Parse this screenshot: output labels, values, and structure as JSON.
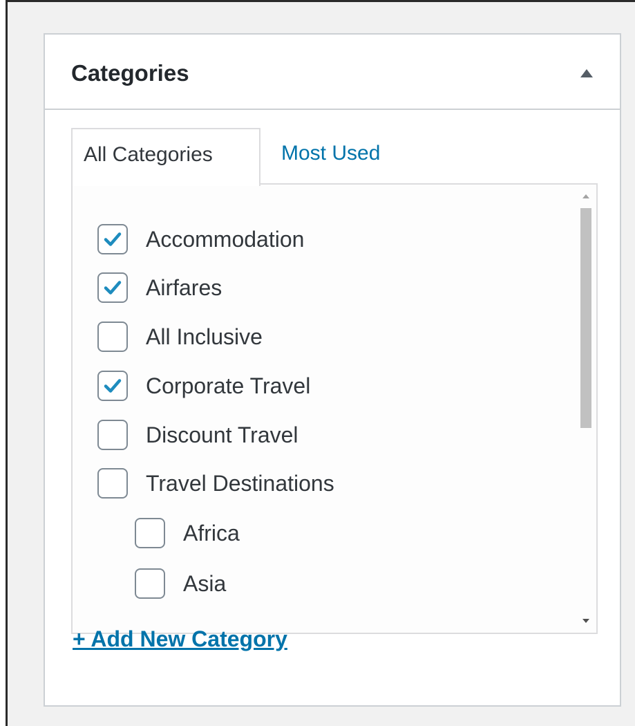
{
  "panel": {
    "title": "Categories",
    "toggle_icon": "arrow-up-icon"
  },
  "tabs": [
    {
      "label": "All Categories",
      "active": true
    },
    {
      "label": "Most Used",
      "active": false
    }
  ],
  "categories": [
    {
      "label": "Accommodation",
      "checked": true,
      "level": 0
    },
    {
      "label": "Airfares",
      "checked": true,
      "level": 0
    },
    {
      "label": "All Inclusive",
      "checked": false,
      "level": 0
    },
    {
      "label": "Corporate Travel",
      "checked": true,
      "level": 0
    },
    {
      "label": "Discount Travel",
      "checked": false,
      "level": 0
    },
    {
      "label": "Travel Destinations",
      "checked": false,
      "level": 0
    },
    {
      "label": "Africa",
      "checked": false,
      "level": 1
    },
    {
      "label": "Asia",
      "checked": false,
      "level": 1
    }
  ],
  "add_new": {
    "label": "+ Add New Category"
  },
  "colors": {
    "accent": "#0073aa",
    "checkmark": "#1e8cbe",
    "text": "#32373c",
    "border": "#ccd0d4"
  }
}
